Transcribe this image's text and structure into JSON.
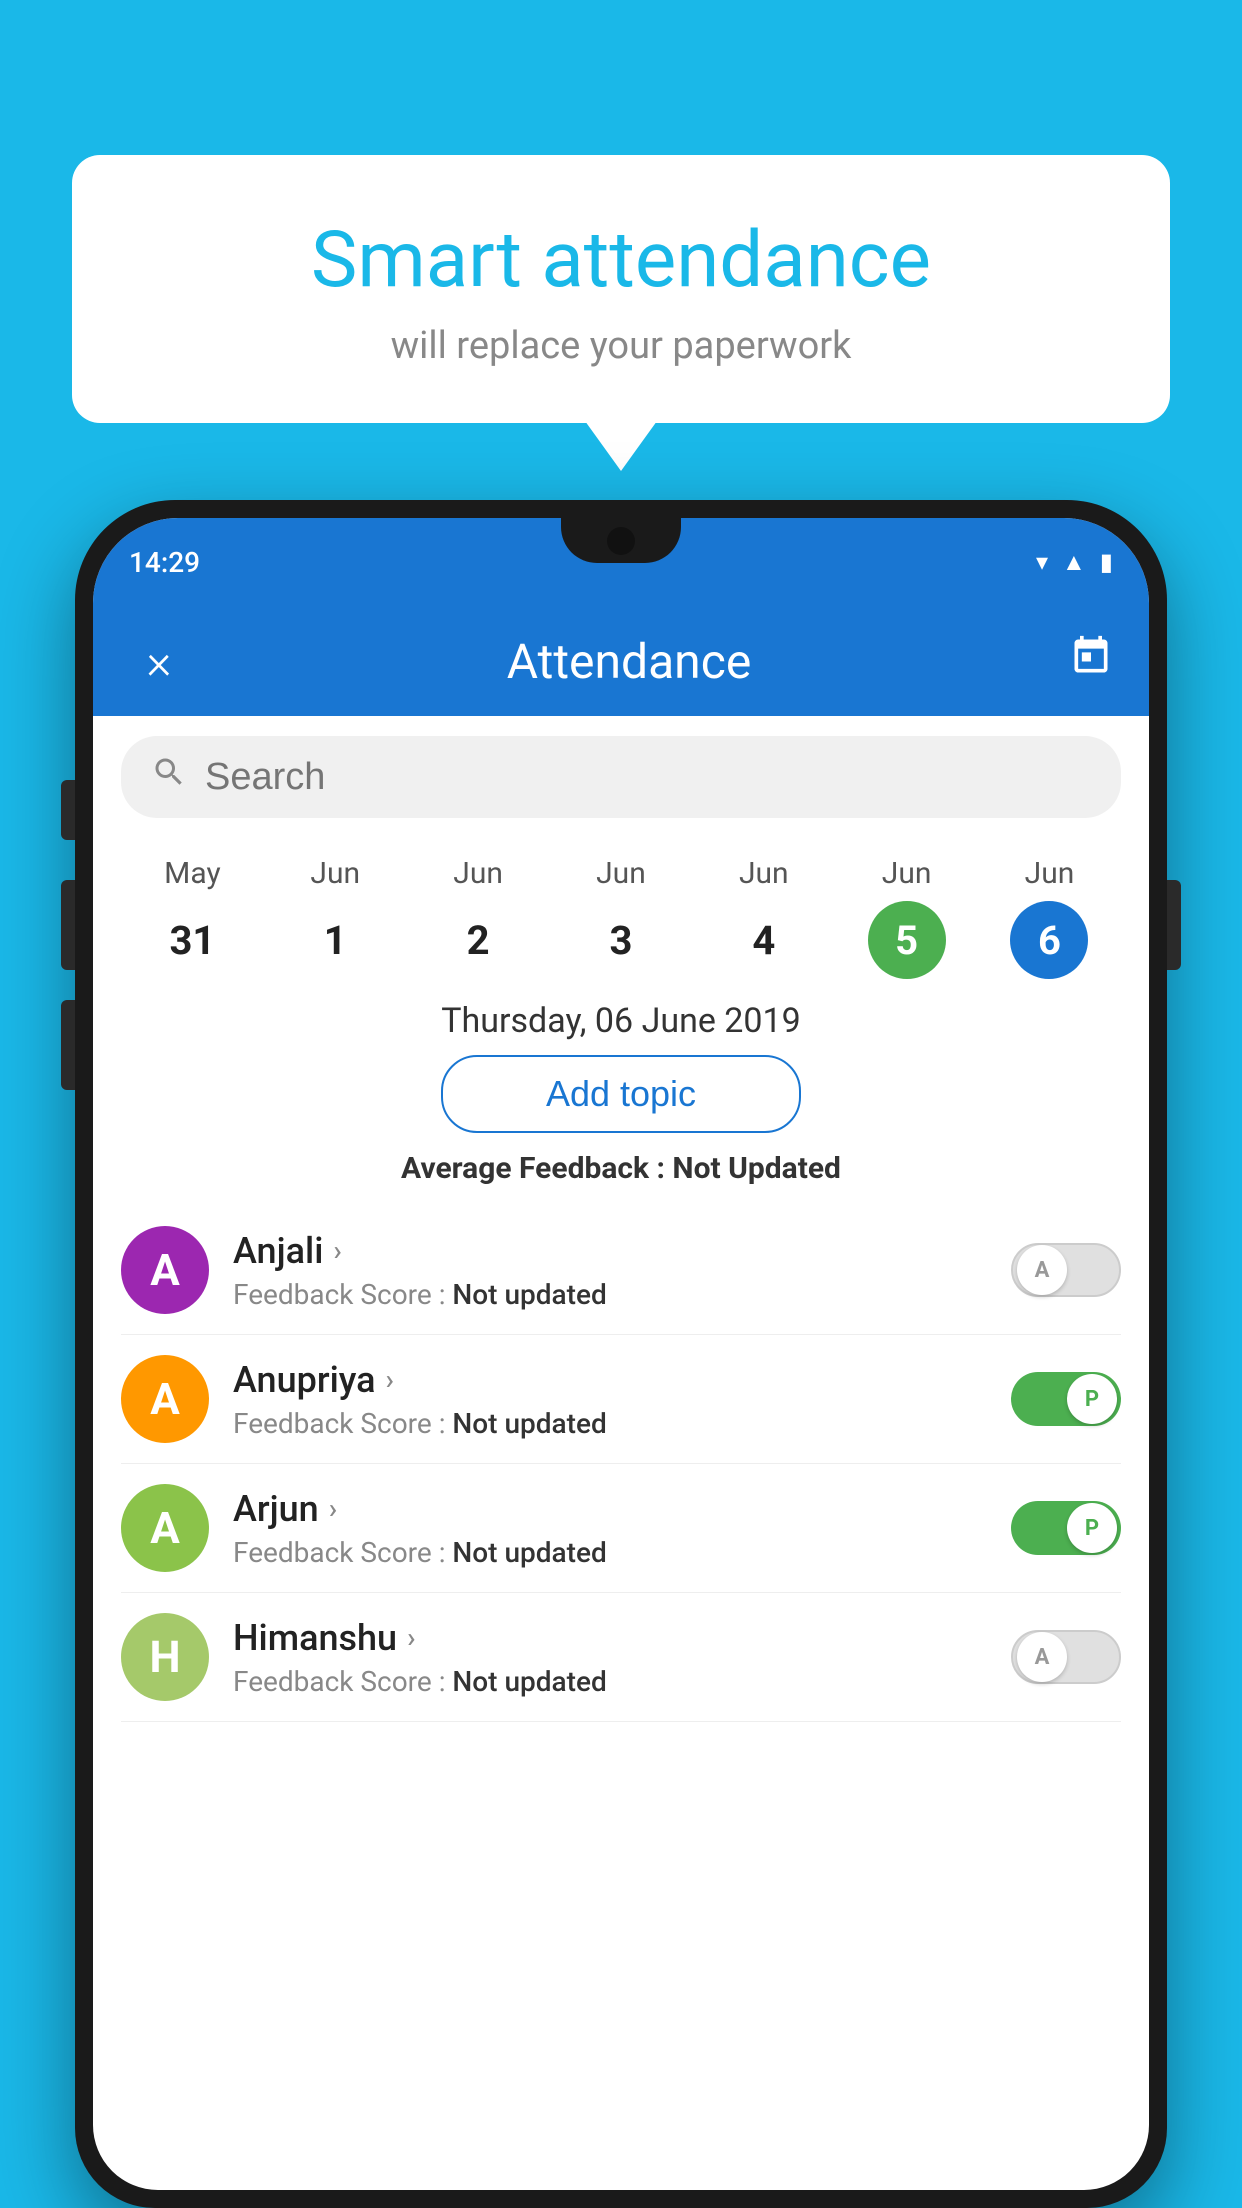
{
  "background_color": "#1ab8e8",
  "bubble": {
    "title": "Smart attendance",
    "subtitle": "will replace your paperwork"
  },
  "status_bar": {
    "time": "14:29",
    "icons": [
      "wifi",
      "signal",
      "battery"
    ]
  },
  "app_bar": {
    "title": "Attendance",
    "close_label": "×",
    "calendar_label": "📅"
  },
  "search": {
    "placeholder": "Search"
  },
  "calendar": {
    "days": [
      {
        "month": "May",
        "date": "31",
        "state": "normal"
      },
      {
        "month": "Jun",
        "date": "1",
        "state": "normal"
      },
      {
        "month": "Jun",
        "date": "2",
        "state": "normal"
      },
      {
        "month": "Jun",
        "date": "3",
        "state": "normal"
      },
      {
        "month": "Jun",
        "date": "4",
        "state": "normal"
      },
      {
        "month": "Jun",
        "date": "5",
        "state": "today"
      },
      {
        "month": "Jun",
        "date": "6",
        "state": "selected"
      }
    ],
    "selected_date_label": "Thursday, 06 June 2019"
  },
  "add_topic_button": "Add topic",
  "avg_feedback": {
    "label": "Average Feedback : ",
    "value": "Not Updated"
  },
  "students": [
    {
      "name": "Anjali",
      "avatar_letter": "A",
      "avatar_color": "#9c27b0",
      "feedback_label": "Feedback Score : ",
      "feedback_value": "Not updated",
      "toggle": "off",
      "toggle_letter": "A"
    },
    {
      "name": "Anupriya",
      "avatar_letter": "A",
      "avatar_color": "#ff9800",
      "feedback_label": "Feedback Score : ",
      "feedback_value": "Not updated",
      "toggle": "on",
      "toggle_letter": "P"
    },
    {
      "name": "Arjun",
      "avatar_letter": "A",
      "avatar_color": "#8bc34a",
      "feedback_label": "Feedback Score : ",
      "feedback_value": "Not updated",
      "toggle": "on",
      "toggle_letter": "P"
    },
    {
      "name": "Himanshu",
      "avatar_letter": "H",
      "avatar_color": "#a5c96a",
      "feedback_label": "Feedback Score : ",
      "feedback_value": "Not updated",
      "toggle": "off",
      "toggle_letter": "A"
    }
  ]
}
